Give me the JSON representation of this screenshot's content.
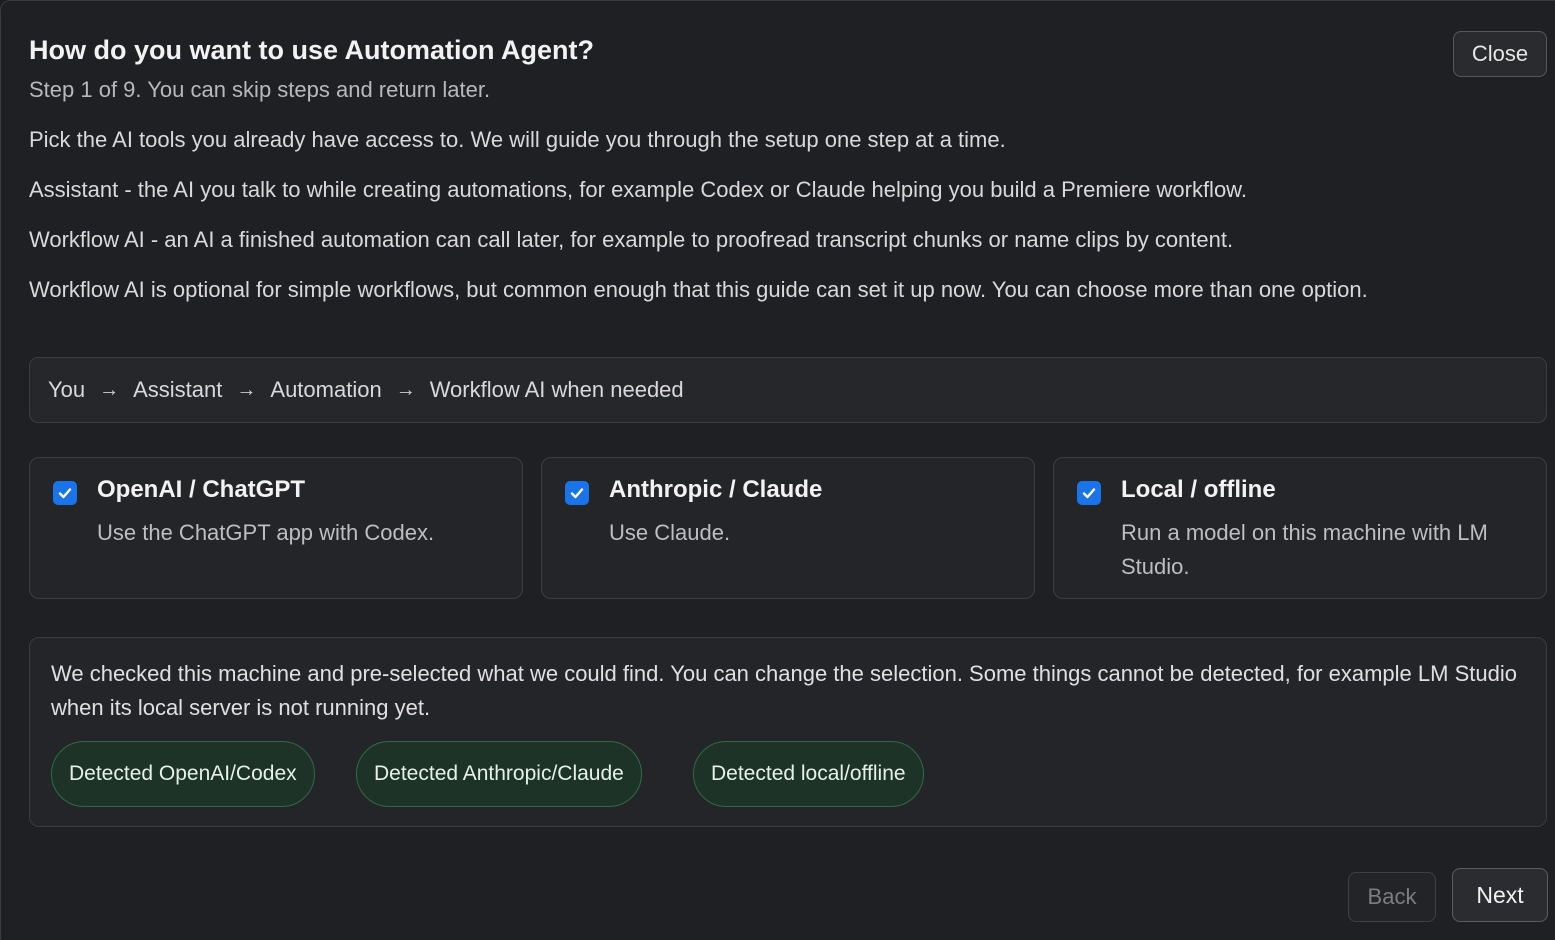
{
  "dialog": {
    "title": "How do you want to use Automation Agent?",
    "subtitle": "Step 1 of 9. You can skip steps and return later.",
    "close_label": "Close"
  },
  "intro": {
    "p1": "Pick the AI tools you already have access to. We will guide you through the setup one step at a time.",
    "p2": "Assistant - the AI you talk to while creating automations, for example Codex or Claude helping you build a Premiere workflow.",
    "p3": "Workflow AI - an AI a finished automation can call later, for example to proofread transcript chunks or name clips by content.",
    "p4": "Workflow AI is optional for simple workflows, but common enough that this guide can set it up now. You can choose more than one option."
  },
  "flow": {
    "steps": [
      "You",
      "Assistant",
      "Automation",
      "Workflow AI when needed"
    ],
    "arrow": "→"
  },
  "options": [
    {
      "title": "OpenAI / ChatGPT",
      "description": "Use the ChatGPT app with Codex.",
      "checked": true
    },
    {
      "title": "Anthropic / Claude",
      "description": "Use Claude.",
      "checked": true
    },
    {
      "title": "Local / offline",
      "description": "Run a model on this machine with LM Studio.",
      "checked": true
    }
  ],
  "detection": {
    "text": "We checked this machine and pre-selected what we could find. You can change the selection. Some things cannot be detected, for example LM Studio when its local server is not running yet.",
    "badges": [
      "Detected OpenAI/Codex",
      "Detected Anthropic/Claude",
      "Detected local/offline"
    ]
  },
  "footer": {
    "back_label": "Back",
    "next_label": "Next"
  },
  "colors": {
    "accent": "#1a73e8",
    "badge_border": "#2f6a45",
    "badge_bg": "#1d3327"
  }
}
